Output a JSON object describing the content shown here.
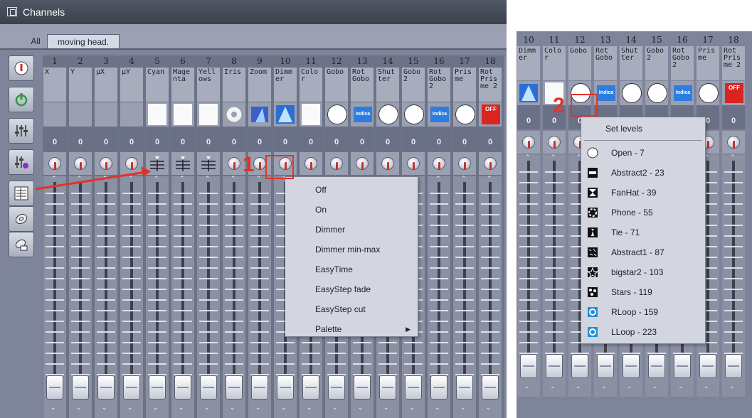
{
  "window": {
    "title": "Channels"
  },
  "tabs": [
    {
      "label": "All"
    },
    {
      "label": "moving head."
    }
  ],
  "main_columns": [
    {
      "num": "1",
      "name": "X",
      "value": "0",
      "image": "none"
    },
    {
      "num": "2",
      "name": "Y",
      "value": "0",
      "image": "none"
    },
    {
      "num": "3",
      "name": "µX",
      "value": "0",
      "image": "none"
    },
    {
      "num": "4",
      "name": "µY",
      "value": "0",
      "image": "none"
    },
    {
      "num": "5",
      "name": "Cyan",
      "value": "0",
      "image": "white"
    },
    {
      "num": "6",
      "name": "Magenta",
      "value": "0",
      "image": "white"
    },
    {
      "num": "7",
      "name": "Yellows",
      "value": "0",
      "image": "white"
    },
    {
      "num": "8",
      "name": "Iris",
      "value": "0",
      "image": "iris"
    },
    {
      "num": "9",
      "name": "Zoom",
      "value": "0",
      "image": "zoom"
    },
    {
      "num": "10",
      "name": "Dimmer",
      "value": "0",
      "image": "dimmer"
    },
    {
      "num": "11",
      "name": "Color",
      "value": "0",
      "image": "white"
    },
    {
      "num": "12",
      "name": "Gobo",
      "value": "0",
      "image": "circle"
    },
    {
      "num": "13",
      "name": "Rot Gobo",
      "value": "0",
      "image": "indica"
    },
    {
      "num": "14",
      "name": "Shutter",
      "value": "0",
      "image": "circle"
    },
    {
      "num": "15",
      "name": "Gobo 2",
      "value": "0",
      "image": "circle"
    },
    {
      "num": "16",
      "name": "Rot Gobo 2",
      "value": "0",
      "image": "indica"
    },
    {
      "num": "17",
      "name": "Prisme",
      "value": "0",
      "image": "circle"
    },
    {
      "num": "18",
      "name": "Rot Prisme 2",
      "value": "0",
      "image": "off"
    }
  ],
  "main_knob_types": [
    "knob",
    "knob",
    "knob",
    "knob",
    "bars",
    "bars",
    "bars",
    "knob",
    "knob",
    "knob",
    "knob",
    "knob",
    "knob",
    "knob",
    "knob",
    "knob",
    "knob",
    "knob"
  ],
  "context_menu": {
    "items": [
      "Off",
      "On",
      "Dimmer",
      "Dimmer min-max",
      "EasyTime",
      "EasyStep fade",
      "EasyStep cut",
      "Palette"
    ],
    "submenu_arrow": "▶"
  },
  "annotations": {
    "label1": "1",
    "label2": "2"
  },
  "zoom_columns": [
    {
      "num": "10",
      "name": "Dimmer",
      "value": "0",
      "image": "dimmer"
    },
    {
      "num": "11",
      "name": "Color",
      "value": "0",
      "image": "white"
    },
    {
      "num": "12",
      "name": "Gobo",
      "value": "0",
      "image": "circle"
    },
    {
      "num": "13",
      "name": "Rot Gobo",
      "value": "0",
      "image": "indica"
    },
    {
      "num": "14",
      "name": "Shutter",
      "value": "0",
      "image": "circle"
    },
    {
      "num": "15",
      "name": "Gobo 2",
      "value": "0",
      "image": "circle"
    },
    {
      "num": "16",
      "name": "Rot Gobo 2",
      "value": "0",
      "image": "indica"
    },
    {
      "num": "17",
      "name": "Prisme",
      "value": "0",
      "image": "circle"
    },
    {
      "num": "18",
      "name": "Rot Prisme 2",
      "value": "0",
      "image": "off"
    }
  ],
  "levels_menu": {
    "title": "Set levels",
    "items": [
      {
        "label": "Open - 7",
        "icon": "open-icon"
      },
      {
        "label": "Abstract2 - 23",
        "icon": "abstract2-icon"
      },
      {
        "label": "FanHat - 39",
        "icon": "fanhat-icon"
      },
      {
        "label": "Phone - 55",
        "icon": "phone-icon"
      },
      {
        "label": "Tie - 71",
        "icon": "tie-icon"
      },
      {
        "label": "Abstract1 - 87",
        "icon": "abstract1-icon"
      },
      {
        "label": "bigstar2 - 103",
        "icon": "bigstar2-icon"
      },
      {
        "label": "Stars - 119",
        "icon": "stars-icon"
      },
      {
        "label": "RLoop - 159",
        "icon": "rloop-icon"
      },
      {
        "label": "LLoop - 223",
        "icon": "lloop-icon"
      }
    ]
  },
  "image_labels": {
    "indica": "Indica",
    "off": "OFF"
  },
  "fader_glyphs": {
    "up": "⌃",
    "down": "⌄"
  }
}
